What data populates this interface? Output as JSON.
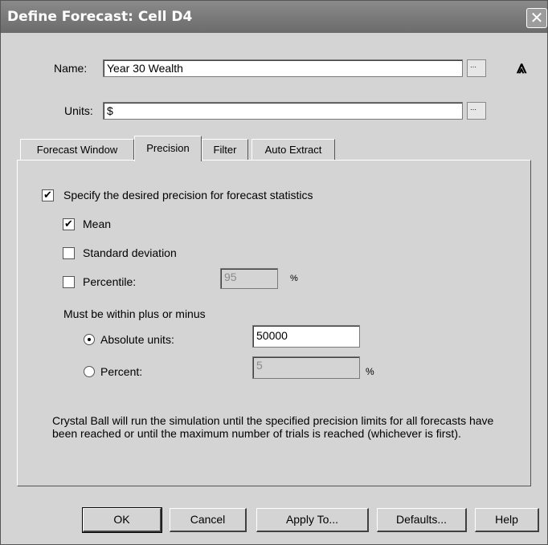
{
  "window": {
    "title": "Define Forecast: Cell D4",
    "close_glyph": "✕"
  },
  "name_field": {
    "label": "Name:",
    "value": "Year 30 Wealth"
  },
  "units_field": {
    "label": "Units:",
    "value": "$"
  },
  "collapse_glyph": "⩓",
  "tabs": [
    {
      "label": "Forecast Window",
      "active": false
    },
    {
      "label": "Precision",
      "active": true
    },
    {
      "label": "Filter",
      "active": false
    },
    {
      "label": "Auto Extract",
      "active": false
    }
  ],
  "precision": {
    "specify_label": "Specify the desired precision for forecast statistics",
    "specify_checked": true,
    "mean_label": "Mean",
    "mean_checked": true,
    "stddev_label": "Standard deviation",
    "stddev_checked": false,
    "percentile_label": "Percentile:",
    "percentile_checked": false,
    "percentile_value": "95",
    "percentile_unit": "%",
    "within_label": "Must be within plus or minus",
    "absolute_label": "Absolute units:",
    "absolute_selected": true,
    "absolute_value": "50000",
    "percent_label": "Percent:",
    "percent_value": "5",
    "percent_unit": "%",
    "info_text": "Crystal Ball will run the simulation until the specified precision limits for all forecasts have been reached or until the maximum number of trials is reached (whichever is first)."
  },
  "buttons": {
    "ok": "OK",
    "cancel": "Cancel",
    "apply": "Apply To...",
    "defaults": "Defaults...",
    "help": "Help"
  },
  "colors": {
    "titlebar": "#7a7a7a",
    "dialog_bg": "#d4d4d4"
  }
}
